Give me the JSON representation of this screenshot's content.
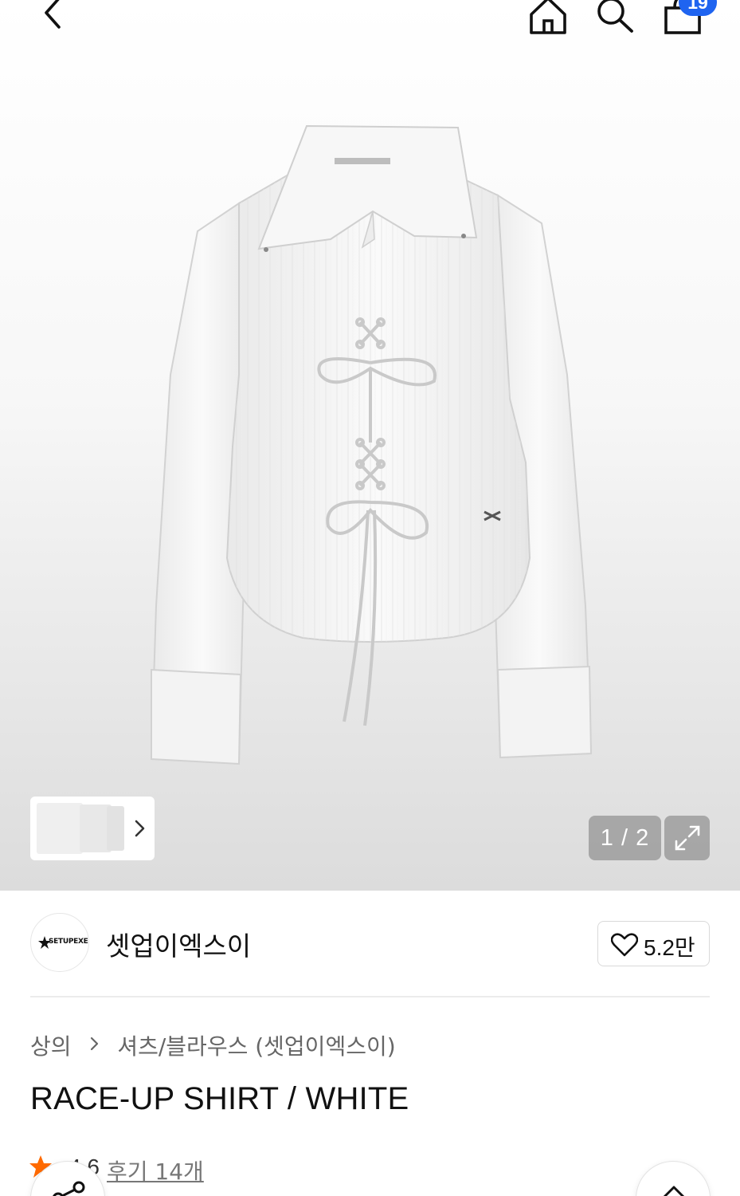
{
  "header": {
    "cart_count": "19",
    "icons": [
      "back-icon",
      "home-icon",
      "search-icon",
      "shopping-bag-icon"
    ]
  },
  "gallery": {
    "counter": "1 / 2",
    "image_alt": "RACE-UP SHIRT / WHITE"
  },
  "brand": {
    "name": "셋업이엑스이",
    "logo_text": "SETUPEXE",
    "likes": "5.2만"
  },
  "breadcrumb": {
    "category": "상의",
    "subcategory": "셔츠/블라우스 (셋업이엑스이)"
  },
  "product": {
    "title": "RACE-UP SHIRT / WHITE",
    "rating": "4.6",
    "reviews": "후기 14개"
  },
  "colors": {
    "badge": "#1f64f0",
    "rating_star": "#ff6a00"
  }
}
